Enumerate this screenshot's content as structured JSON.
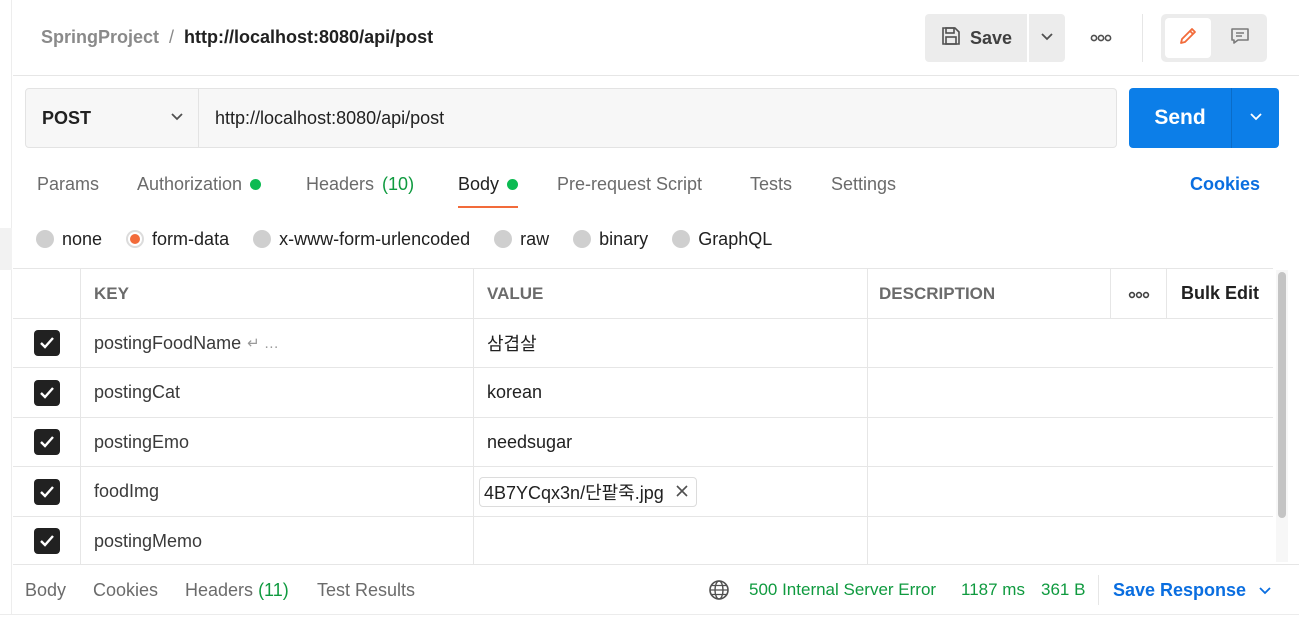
{
  "header": {
    "project": "SpringProject",
    "separator": "/",
    "request_name": "http://localhost:8080/api/post",
    "save_label": "Save"
  },
  "request": {
    "method": "POST",
    "url": "http://localhost:8080/api/post",
    "send_label": "Send"
  },
  "tabs": [
    {
      "label": "Params"
    },
    {
      "label": "Authorization"
    },
    {
      "label": "Headers",
      "count": "(10)"
    },
    {
      "label": "Body"
    },
    {
      "label": "Pre-request Script"
    },
    {
      "label": "Tests"
    },
    {
      "label": "Settings"
    }
  ],
  "cookies_label": "Cookies",
  "body_types": [
    {
      "label": "none",
      "selected": false
    },
    {
      "label": "form-data",
      "selected": true
    },
    {
      "label": "x-www-form-urlencoded",
      "selected": false
    },
    {
      "label": "raw",
      "selected": false
    },
    {
      "label": "binary",
      "selected": false
    },
    {
      "label": "GraphQL",
      "selected": false
    }
  ],
  "table": {
    "headers": {
      "key": "KEY",
      "value": "VALUE",
      "description": "DESCRIPTION",
      "bulk_edit": "Bulk Edit"
    },
    "rows": [
      {
        "key": "postingFoodName",
        "key_suffix": "↵ …",
        "value": "삼겹살",
        "checked": true
      },
      {
        "key": "postingCat",
        "key_suffix": "",
        "value": "korean",
        "checked": true
      },
      {
        "key": "postingEmo",
        "key_suffix": "",
        "value": "needsugar",
        "checked": true
      },
      {
        "key": "foodImg",
        "key_suffix": "",
        "value": "4B7YCqx3n/단팥죽.jpg",
        "checked": true
      },
      {
        "key": "postingMemo",
        "key_suffix": "",
        "value": "",
        "checked": true
      }
    ]
  },
  "response": {
    "tabs": [
      {
        "label": "Body"
      },
      {
        "label": "Cookies"
      },
      {
        "label": "Headers",
        "count": "(11)"
      },
      {
        "label": "Test Results"
      }
    ],
    "status": "500 Internal Server Error",
    "time": "1187 ms",
    "size": "361 B",
    "save_label": "Save Response"
  },
  "colors": {
    "accent": "#f26b3a",
    "primary": "#0c7ee8",
    "success": "#0f9a3f",
    "dot": "#0cbb52"
  }
}
